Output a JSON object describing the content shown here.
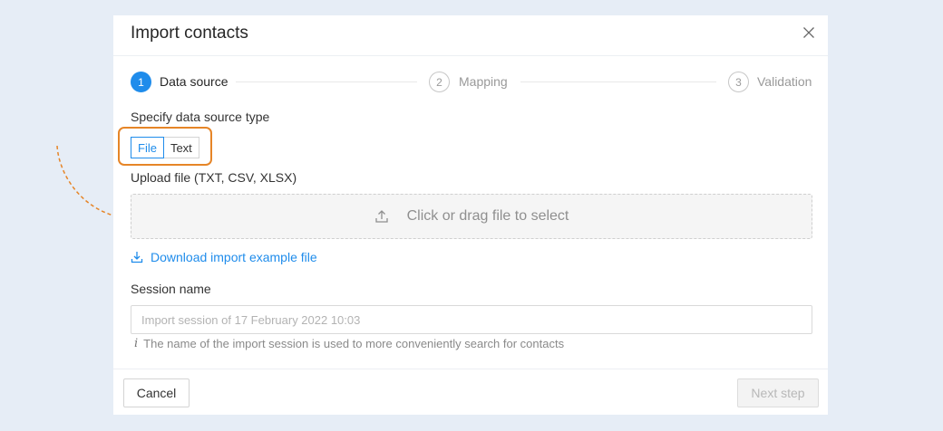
{
  "modal": {
    "title": "Import contacts"
  },
  "steps": [
    {
      "number": "1",
      "label": "Data source",
      "active": true
    },
    {
      "number": "2",
      "label": "Mapping",
      "active": false
    },
    {
      "number": "3",
      "label": "Validation",
      "active": false
    }
  ],
  "data_source": {
    "label": "Specify data source type",
    "options": [
      "File",
      "Text"
    ],
    "selected": "File"
  },
  "upload": {
    "label": "Upload file (TXT, CSV, XLSX)",
    "dropzone_text": "Click or drag file to select",
    "icon": "upload-icon"
  },
  "download_example": {
    "label": "Download import example file",
    "icon": "download-icon"
  },
  "session": {
    "label": "Session name",
    "value": "",
    "placeholder": "Import session of 17 February 2022 10:03",
    "hint_icon": "i",
    "hint": "The name of the import session is used to more conveniently search for contacts"
  },
  "footer": {
    "cancel_label": "Cancel",
    "next_label": "Next step"
  },
  "colors": {
    "accent": "#1f8ceb",
    "highlight": "#e68527",
    "background": "#e6edf6"
  }
}
